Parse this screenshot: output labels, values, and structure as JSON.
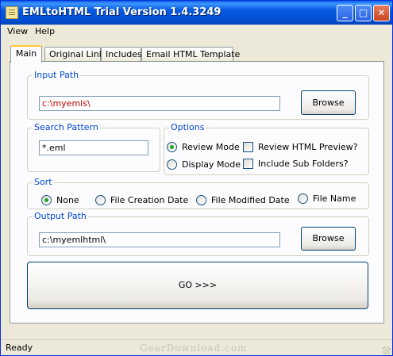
{
  "window": {
    "title": "EMLtoHTML Trial Version 1.4.3249"
  },
  "titlebar": {
    "minimize_glyph": "_",
    "maximize_glyph": "□",
    "close_glyph": "✕"
  },
  "menubar": {
    "items": [
      {
        "label": "View"
      },
      {
        "label": "Help"
      }
    ]
  },
  "tabs": [
    {
      "label": "Main",
      "active": true
    },
    {
      "label": "Original Link"
    },
    {
      "label": "Includes"
    },
    {
      "label": "Email HTML Template"
    }
  ],
  "input_path": {
    "legend": "Input Path",
    "value": "c:\\myemls\\",
    "value_color": "#c00000",
    "browse_label": "Browse"
  },
  "search_pattern": {
    "legend": "Search Pattern",
    "value": "*.eml"
  },
  "options": {
    "legend": "Options",
    "review_mode": "Review Mode",
    "display_mode": "Display Mode",
    "selected_mode": "Review Mode",
    "review_html_preview": "Review HTML Preview?",
    "include_sub_folders": "Include Sub Folders?"
  },
  "sort": {
    "legend": "Sort",
    "selected": "None",
    "options": [
      "None",
      "File Creation Date",
      "File Modified Date",
      "File Name"
    ]
  },
  "output_path": {
    "legend": "Output Path",
    "value": "c:\\myemlhtml\\",
    "browse_label": "Browse"
  },
  "go_button": {
    "label": "GO >>>"
  },
  "status": {
    "text": "Ready"
  },
  "watermark": "GearDownload.com",
  "colors": {
    "title_bar": "#0458e0",
    "legend_text": "#0046d5",
    "window_bg": "#ece9d8",
    "panel_bg": "#fcfcfe"
  }
}
